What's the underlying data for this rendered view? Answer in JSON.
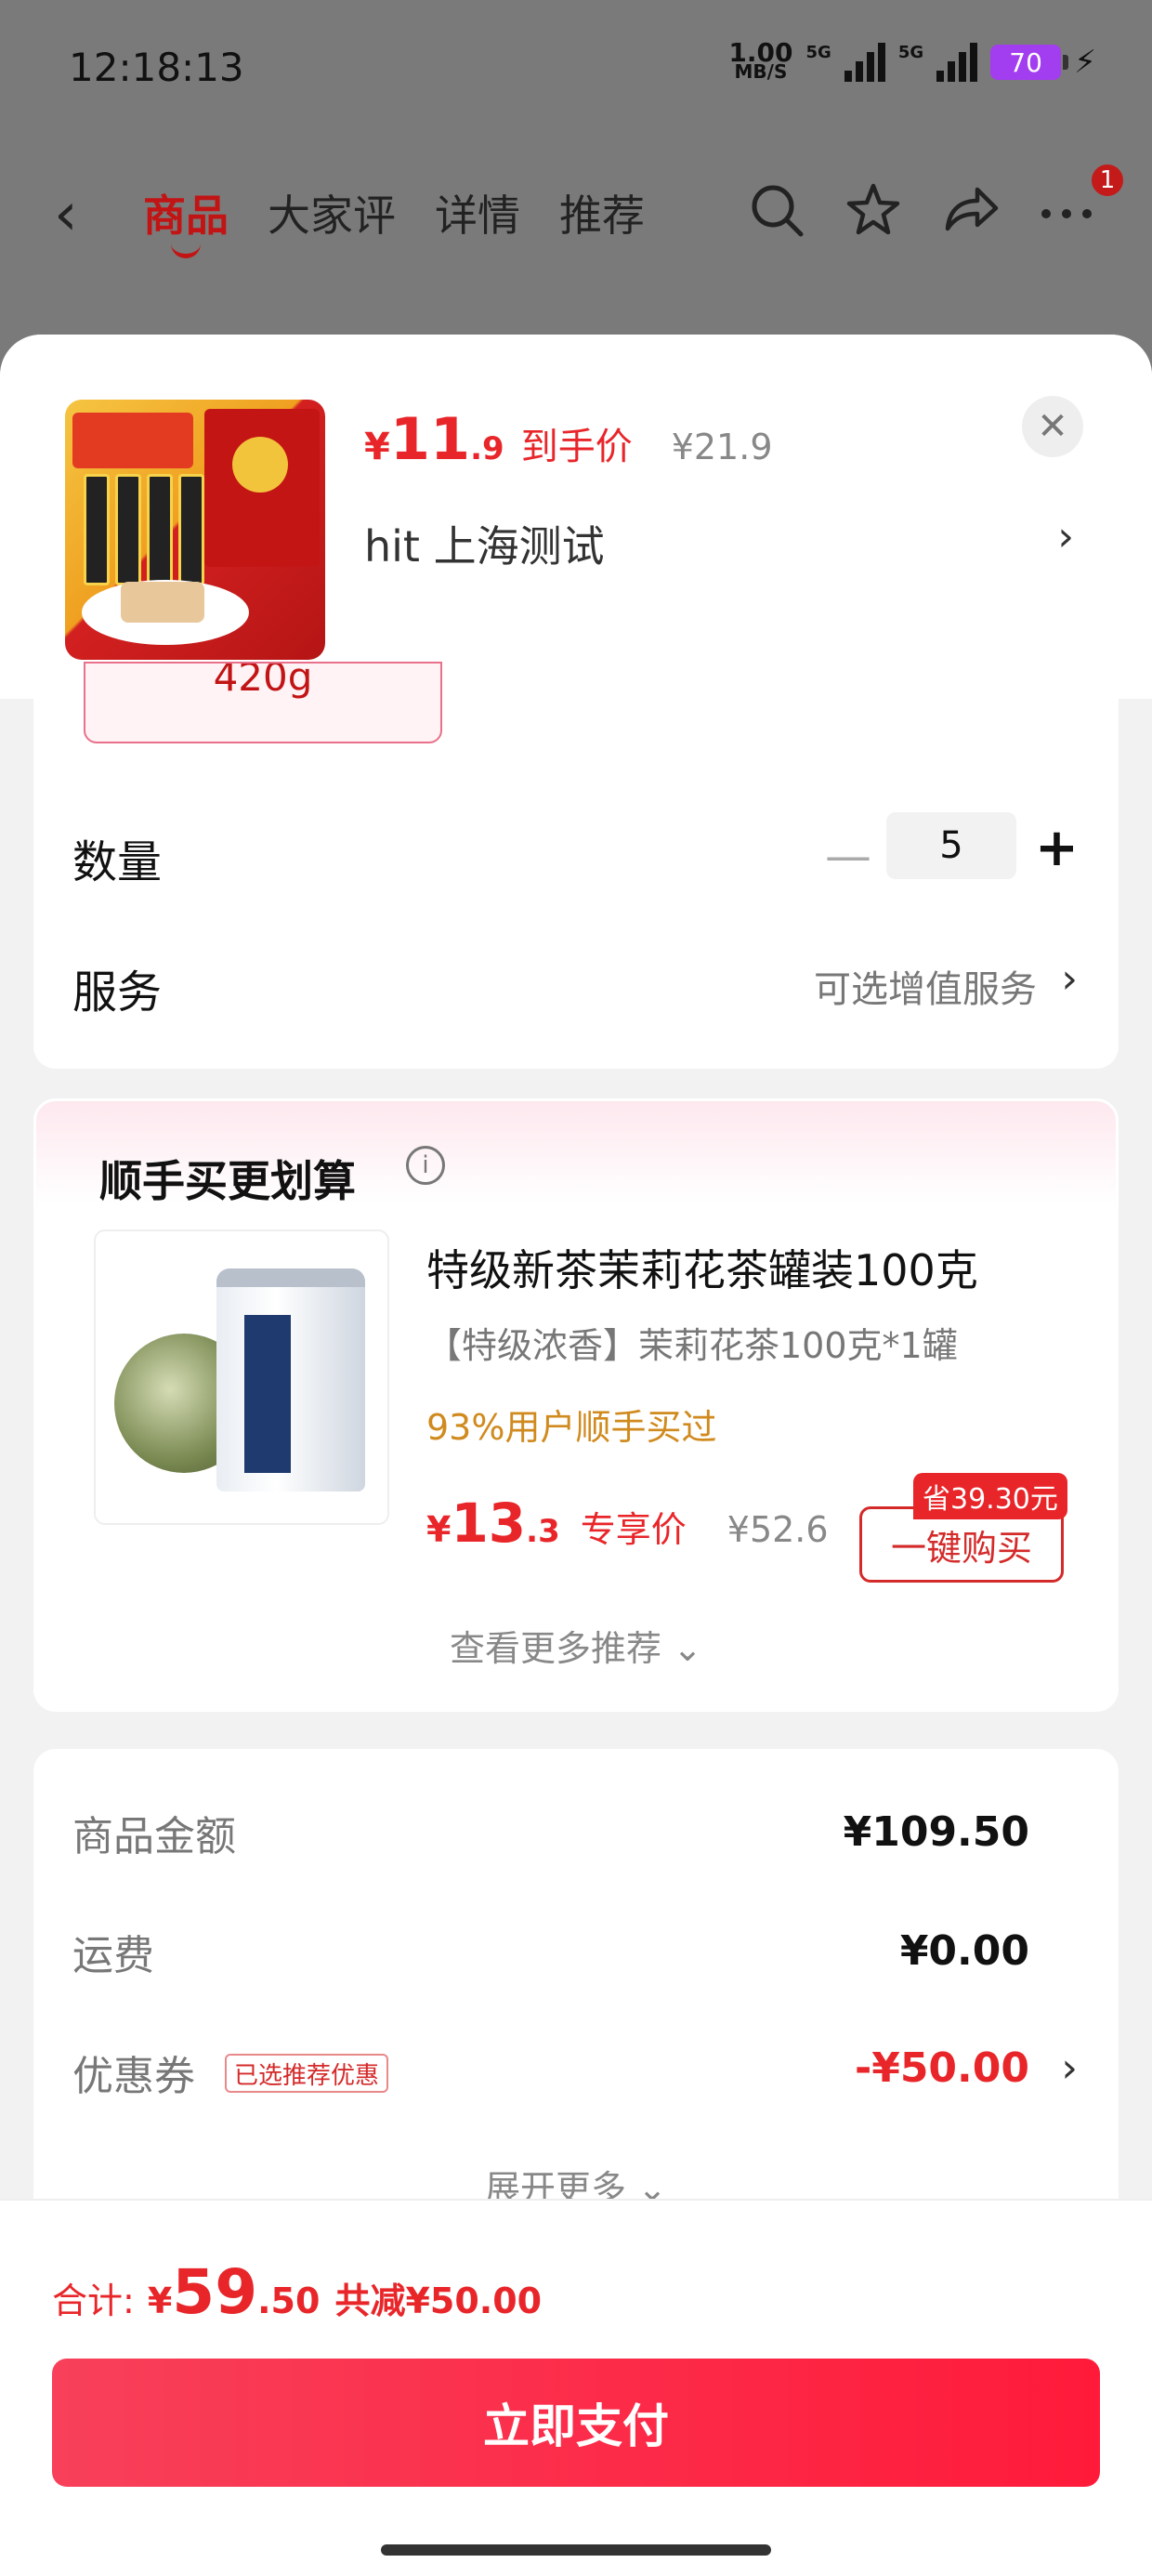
{
  "status_bar": {
    "time": "12:18:13",
    "net_speed": "1.00",
    "net_unit": "MB/S",
    "signal1": "5G",
    "signal2": "5G",
    "battery": "70"
  },
  "nav": {
    "tabs": [
      {
        "label": "商品",
        "active": true
      },
      {
        "label": "大家评",
        "active": false
      },
      {
        "label": "详情",
        "active": false
      },
      {
        "label": "推荐",
        "active": false
      }
    ],
    "badge_count": "1"
  },
  "product": {
    "price_currency": "¥",
    "price_int": "11",
    "price_dec": ".9",
    "price_label": "到手价",
    "original_price": "¥21.9",
    "address": "hit  上海测试",
    "spec_chip": "420g"
  },
  "quantity": {
    "label": "数量",
    "value": "5"
  },
  "service": {
    "label": "服务",
    "value": "可选增值服务"
  },
  "recommend": {
    "title": "顺手买更划算",
    "item_name": "特级新茶茉莉花茶罐装100克",
    "item_spec": "【特级浓香】茉莉花茶100克*1罐",
    "item_rate": "93%用户顺手买过",
    "price_currency": "¥",
    "price_int": "13",
    "price_dec": ".3",
    "price_label": "专享价",
    "original_price": "¥52.6",
    "save_tag": "省39.30元",
    "buy_label": "一键购买",
    "more_label": "查看更多推荐 ⌄"
  },
  "summary": {
    "rows": [
      {
        "label": "商品金额",
        "value": "¥109.50"
      },
      {
        "label": "运费",
        "value": "¥0.00"
      },
      {
        "label": "优惠券",
        "value": "-¥50.00"
      }
    ],
    "coupon_tag": "已选推荐优惠",
    "more_label": "展开更多 ⌄"
  },
  "footer": {
    "total_label": "合计:",
    "total_currency": "¥",
    "total_int": "59",
    "total_dec": ".50",
    "saved": "共减¥50.00",
    "pay_label": "立即支付"
  },
  "colors": {
    "accent_red": "#e8262a",
    "brand_red": "#c21414",
    "rate_orange": "#d08a1e"
  }
}
